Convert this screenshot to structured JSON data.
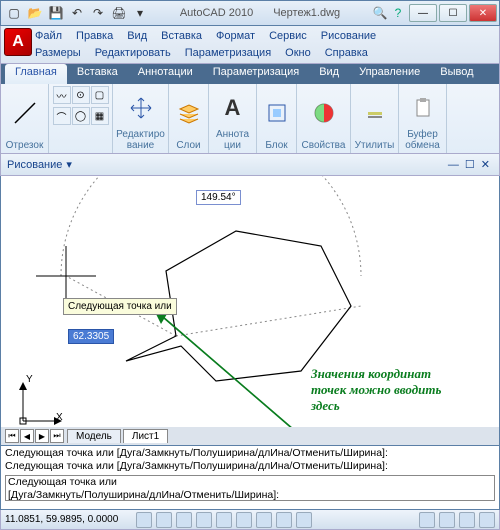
{
  "title": {
    "app": "AutoCAD 2010",
    "file": "Чертеж1.dwg"
  },
  "menus": {
    "row1": [
      "Файл",
      "Правка",
      "Вид",
      "Вставка",
      "Формат",
      "Сервис",
      "Рисование"
    ],
    "row2": [
      "Размеры",
      "Редактировать",
      "Параметризация",
      "Окно",
      "Справка"
    ]
  },
  "tabs": [
    "Главная",
    "Вставка",
    "Аннотации",
    "Параметризация",
    "Вид",
    "Управление",
    "Вывод"
  ],
  "active_tab": 0,
  "ribbon": {
    "groups": [
      {
        "label": "Отрезок",
        "icon": "line"
      },
      {
        "label": "",
        "icon": "draw-grid"
      },
      {
        "label": "Редактиро\nвание",
        "icon": "move"
      },
      {
        "label": "Слои",
        "icon": "layers"
      },
      {
        "label": "Аннота\nции",
        "icon": "text"
      },
      {
        "label": "Блок",
        "icon": "block"
      },
      {
        "label": "Свойства",
        "icon": "props"
      },
      {
        "label": "Утилиты",
        "icon": "utils"
      },
      {
        "label": "Буфер\nобмена",
        "icon": "clip"
      }
    ]
  },
  "panel_head": "Рисование",
  "drawing": {
    "angle": "149.54°",
    "length": "62.3305",
    "tooltip": "Следующая точка или",
    "axes": {
      "y": "Y",
      "x": "X"
    }
  },
  "annotation": "Значения координат\nточек можно вводить\nздесь",
  "layout_tabs": [
    "Модель",
    "Лист1"
  ],
  "cmd": {
    "line1": " Следующая точка или [Дуга/Замкнуть/Полуширина/длИна/Отменить/Ширина]:",
    "line2": " Следующая точка или [Дуга/Замкнуть/Полуширина/длИна/Отменить/Ширина]:",
    "input1": "Следующая точка или",
    "input2": "[Дуга/Замкнуть/Полуширина/длИна/Отменить/Ширина]:"
  },
  "status": {
    "coords": "11.0851, 59.9895, 0.0000"
  }
}
